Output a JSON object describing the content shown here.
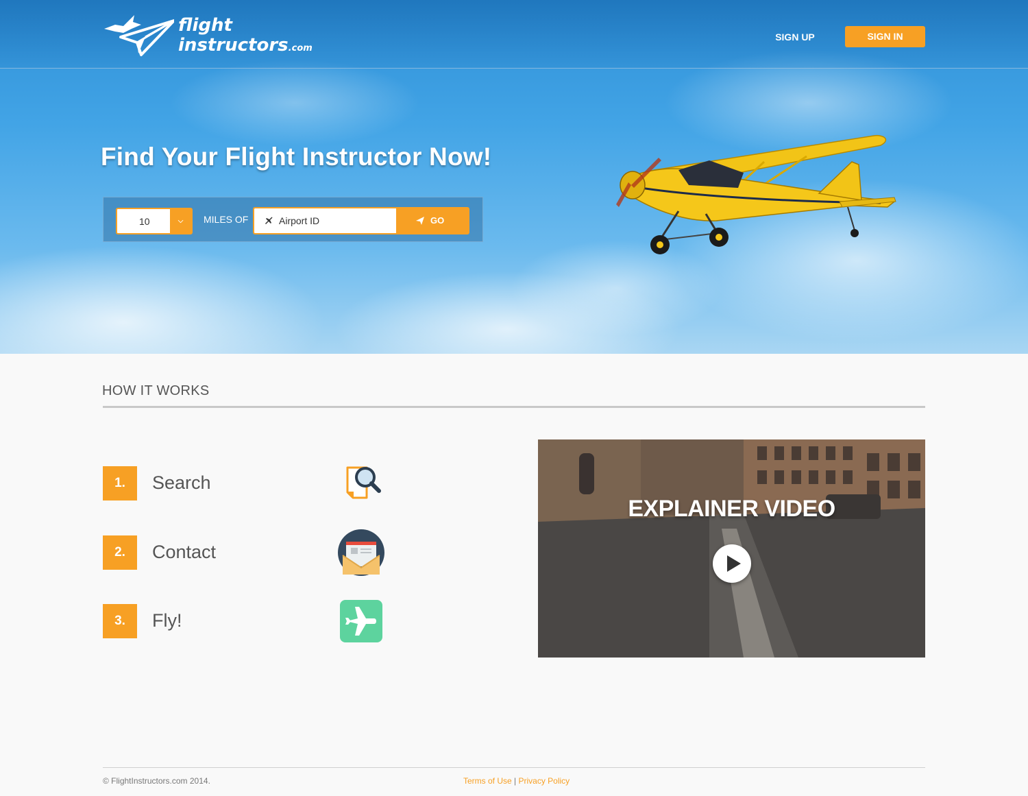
{
  "header": {
    "logo_line1": "flight",
    "logo_line2": "instructors",
    "logo_suffix": ".com",
    "signup_label": "SIGN UP",
    "signin_label": "SIGN IN"
  },
  "hero": {
    "title": "Find Your Flight Instructor Now!",
    "miles_value": "10",
    "miles_label": "MILES OF",
    "airport_placeholder": "Airport ID",
    "go_label": "GO"
  },
  "how": {
    "title": "HOW IT WORKS",
    "steps": [
      {
        "number": "1.",
        "label": "Search",
        "icon": "search-document-icon"
      },
      {
        "number": "2.",
        "label": "Contact",
        "icon": "envelope-icon"
      },
      {
        "number": "3.",
        "label": "Fly!",
        "icon": "airplane-icon"
      }
    ]
  },
  "video": {
    "title": "EXPLAINER VIDEO",
    "icon": "play-icon"
  },
  "footer": {
    "copyright": "© FlightInstructors.com 2014.",
    "terms_label": "Terms of Use",
    "separator": "|",
    "privacy_label": "Privacy Policy"
  },
  "colors": {
    "accent": "#f7a024",
    "sky": "#42a4e6",
    "text": "#555555",
    "flyGreen": "#5dd39e",
    "envelopeBg": "#34495e"
  }
}
